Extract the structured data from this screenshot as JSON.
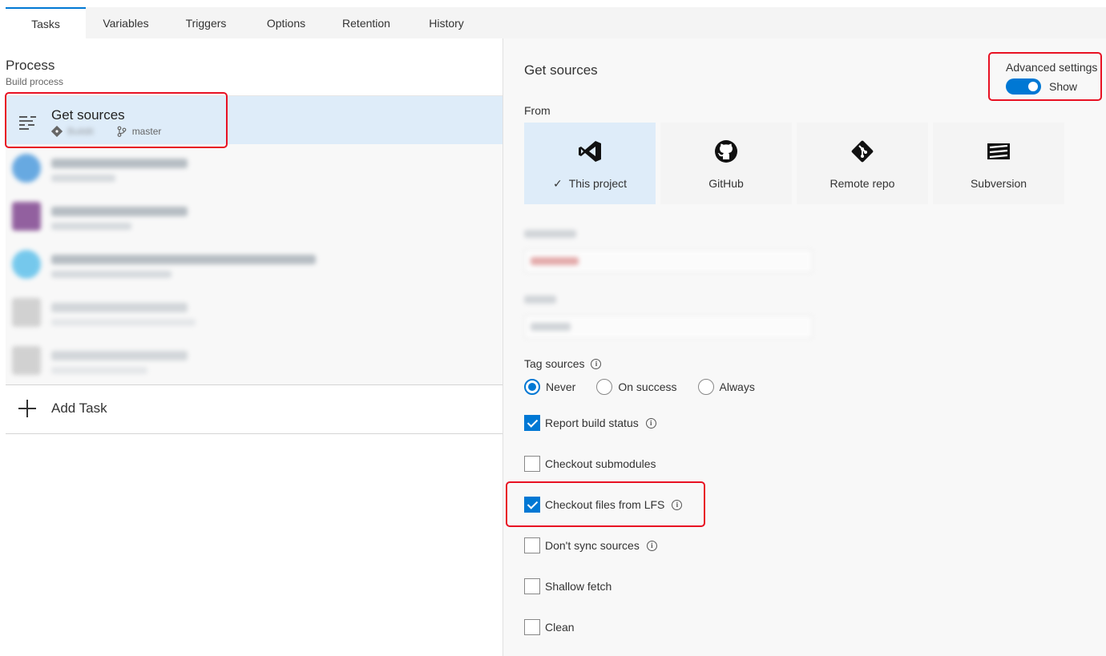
{
  "tabs": [
    "Tasks",
    "Variables",
    "Triggers",
    "Options",
    "Retention",
    "History"
  ],
  "process": {
    "title": "Process",
    "subtitle": "Build process"
  },
  "get_sources_task": {
    "name": "Get sources",
    "repo": "Buildit",
    "branch": "master"
  },
  "add_task_label": "Add Task",
  "right": {
    "title": "Get sources",
    "advanced_label": "Advanced settings",
    "toggle_label": "Show",
    "toggle_on": true,
    "from_label": "From",
    "sources": [
      {
        "label": "This project",
        "icon": "visual-studio-icon",
        "selected": true
      },
      {
        "label": "GitHub",
        "icon": "github-icon",
        "selected": false
      },
      {
        "label": "Remote repo",
        "icon": "git-icon",
        "selected": false
      },
      {
        "label": "Subversion",
        "icon": "subversion-icon",
        "selected": false
      }
    ],
    "tag_sources_label": "Tag sources",
    "tag_options": [
      "Never",
      "On success",
      "Always"
    ],
    "tag_selected": "Never",
    "checkboxes": {
      "report_build_status": {
        "label": "Report build status",
        "checked": true
      },
      "checkout_submodules": {
        "label": "Checkout submodules",
        "checked": false
      },
      "checkout_lfs": {
        "label": "Checkout files from LFS",
        "checked": true
      },
      "dont_sync": {
        "label": "Don't sync sources",
        "checked": false
      },
      "shallow_fetch": {
        "label": "Shallow fetch",
        "checked": false
      },
      "clean": {
        "label": "Clean",
        "checked": false
      }
    }
  },
  "colors": {
    "accent": "#0078d4",
    "highlight": "#e81123",
    "selected_bg": "#deecf9"
  }
}
